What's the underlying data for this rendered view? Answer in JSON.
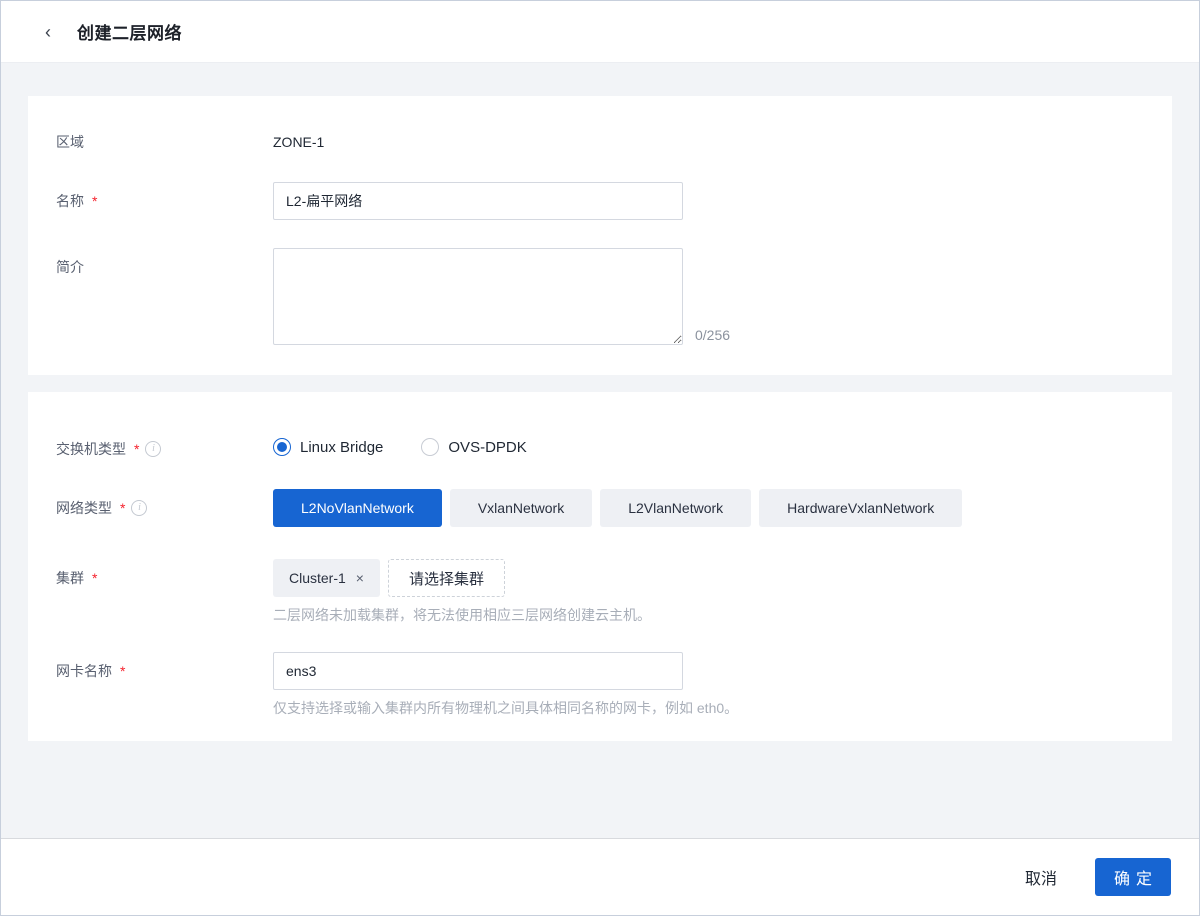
{
  "header": {
    "back_icon": "‹",
    "title": "创建二层网络"
  },
  "colors": {
    "accent": "#1765d2",
    "required": "#f5222d",
    "chip_bg": "#eef0f4"
  },
  "form": {
    "zone": {
      "label": "区域",
      "value": "ZONE-1"
    },
    "name": {
      "label": "名称",
      "required_mark": "*",
      "value": "L2-扁平网络"
    },
    "description": {
      "label": "简介",
      "value": "",
      "counter": "0/256"
    },
    "switch_type": {
      "label": "交换机类型",
      "required_mark": "*",
      "info_icon": "i",
      "options": [
        {
          "label": "Linux Bridge",
          "selected": true
        },
        {
          "label": "OVS-DPDK",
          "selected": false
        }
      ]
    },
    "network_type": {
      "label": "网络类型",
      "required_mark": "*",
      "info_icon": "i",
      "selected": "L2NoVlanNetwork",
      "options": [
        {
          "label": "L2NoVlanNetwork"
        },
        {
          "label": "VxlanNetwork"
        },
        {
          "label": "L2VlanNetwork"
        },
        {
          "label": "HardwareVxlanNetwork"
        }
      ]
    },
    "cluster": {
      "label": "集群",
      "required_mark": "*",
      "tag": "Cluster-1",
      "tag_remove_icon": "×",
      "select_button": "请选择集群",
      "hint": "二层网络未加载集群，将无法使用相应三层网络创建云主机。"
    },
    "nic": {
      "label": "网卡名称",
      "required_mark": "*",
      "value": "ens3",
      "hint": "仅支持选择或输入集群内所有物理机之间具体相同名称的网卡，例如 eth0。"
    }
  },
  "footer": {
    "cancel_label": "取消",
    "confirm_label": "确定"
  }
}
